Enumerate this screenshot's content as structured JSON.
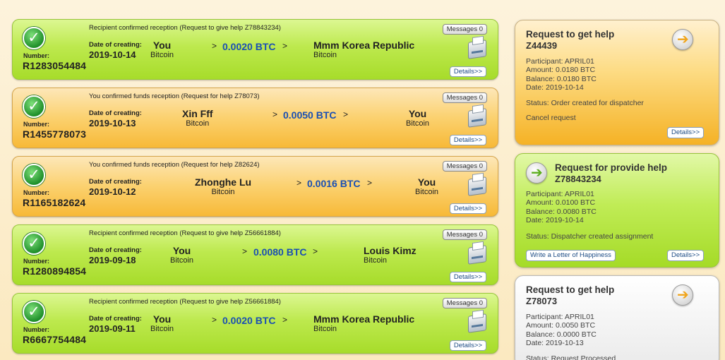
{
  "colors": {
    "green": "#b4e33c",
    "orange": "#f9c958",
    "amount_blue": "#1a4fb3",
    "grey": "#eaeaea"
  },
  "transactions": [
    {
      "title": "Recipient confirmed reception (Request to give help Z78843234)",
      "number_label": "Number:",
      "number": "R1283054484",
      "date_label": "Date of creating:",
      "date": "2019-10-14",
      "from": "You",
      "from_currency": "Bitcoin",
      "amount": "0.0020 BTC",
      "to": "Mmm Korea Republic",
      "to_currency": "Bitcoin",
      "messages_label": "Messages 0",
      "details_label": "Details>>",
      "arrow": ">"
    },
    {
      "title": "You confirmed funds reception (Request for help Z78073)",
      "number_label": "Number:",
      "number": "R1455778073",
      "date_label": "Date of creating:",
      "date": "2019-10-13",
      "from": "Xin Fff",
      "from_currency": "Bitcoin",
      "amount": "0.0050 BTC",
      "to": "You",
      "to_currency": "Bitcoin",
      "messages_label": "Messages 0",
      "details_label": "Details>>",
      "arrow": ">"
    },
    {
      "title": "You confirmed funds reception (Request for help Z82624)",
      "number_label": "Number:",
      "number": "R1165182624",
      "date_label": "Date of creating:",
      "date": "2019-10-12",
      "from": "Zhonghe Lu",
      "from_currency": "Bitcoin",
      "amount": "0.0016 BTC",
      "to": "You",
      "to_currency": "Bitcoin",
      "messages_label": "Messages 0",
      "details_label": "Details>>",
      "arrow": ">"
    },
    {
      "title": "Recipient confirmed reception (Request to give help Z56661884)",
      "number_label": "Number:",
      "number": "R1280894854",
      "date_label": "Date of creating:",
      "date": "2019-09-18",
      "from": "You",
      "from_currency": "Bitcoin",
      "amount": "0.0080 BTC",
      "to": "Louis Kimz",
      "to_currency": "Bitcoin",
      "messages_label": "Messages 0",
      "details_label": "Details>>",
      "arrow": ">"
    },
    {
      "title": "Recipient confirmed reception (Request to give help Z56661884)",
      "number_label": "Number:",
      "number": "R6667754484",
      "date_label": "Date of creating:",
      "date": "2019-09-11",
      "from": "You",
      "from_currency": "Bitcoin",
      "amount": "0.0020 BTC",
      "to": "Mmm Korea Republic",
      "to_currency": "Bitcoin",
      "messages_label": "Messages 0",
      "details_label": "Details>>",
      "arrow": ">"
    }
  ],
  "requests": [
    {
      "title": "Request to get help",
      "id": "Z44439",
      "lines": [
        "Participant: APRIL01",
        "Amount: 0.0180 BTC",
        "Balance: 0.0180 BTC",
        "Date: 2019-10-14"
      ],
      "status": "Status: Order created for dispatcher",
      "cancel": "Cancel request",
      "details_label": "Details>>"
    },
    {
      "title": "Request for provide help",
      "id": "Z78843234",
      "lines": [
        "Participant: APRIL01",
        "Amount: 0.0100 BTC",
        "Balance: 0.0080 BTC",
        "Date: 2019-10-14"
      ],
      "status": "Status: Dispatcher created assignment",
      "letter_label": "Write a Letter of Happiness",
      "details_label": "Details>>"
    },
    {
      "title": "Request to get help",
      "id": "Z78073",
      "lines": [
        "Participant: APRIL01",
        "Amount: 0.0050 BTC",
        "Balance: 0.0000 BTC",
        "Date: 2019-10-13"
      ],
      "status": "Status: Request Processed"
    }
  ]
}
